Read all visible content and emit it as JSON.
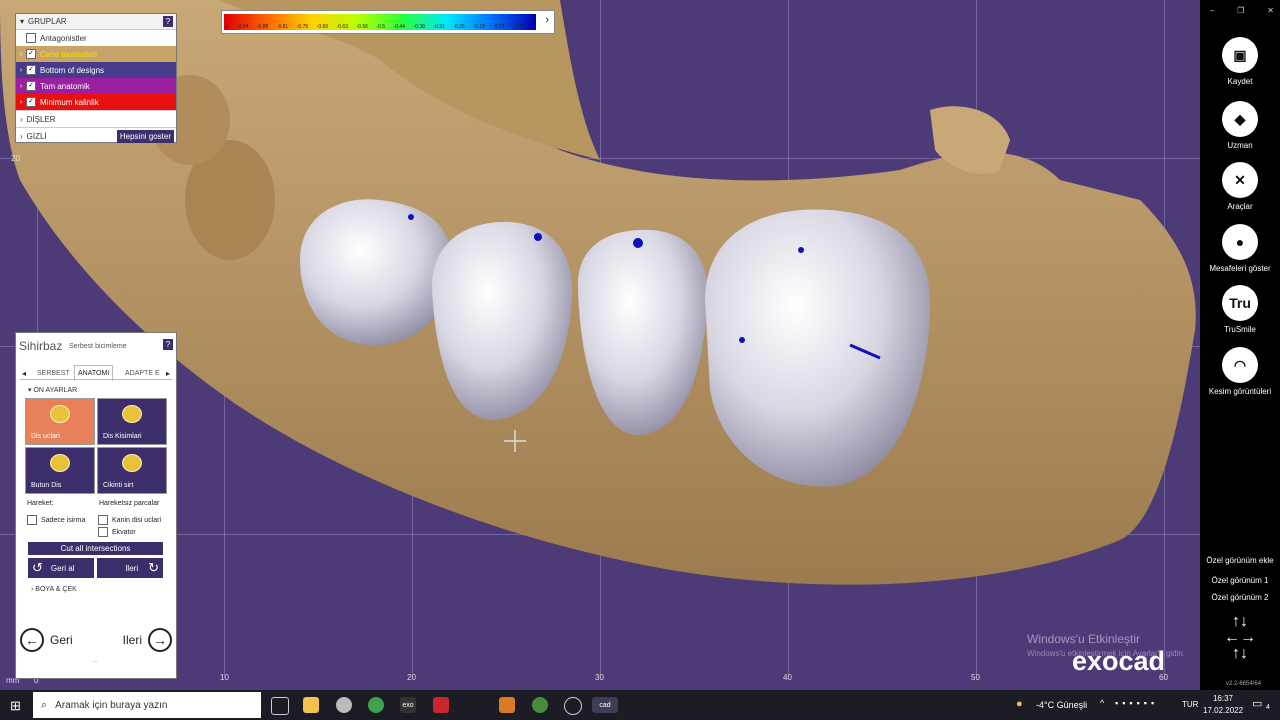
{
  "colorbar": {
    "ticks": [
      "-1",
      "-0.94",
      "-0.88",
      "-0.81",
      "-0.75",
      "-0.69",
      "-0.63",
      "-0.56",
      "-0.5",
      "-0.44",
      "-0.38",
      "-0.31",
      "-0.25",
      "-0.19",
      "-0.13",
      "-0.06",
      "0"
    ],
    "arrow": "›"
  },
  "groups": {
    "title": "GRUPLAR",
    "help": "?",
    "items": [
      {
        "label": "Antagonistler",
        "checked": false,
        "color": "#ffffff",
        "text_color": "#333333"
      },
      {
        "label": "Cene taramalari",
        "checked": true,
        "color": "#c8a46a",
        "text_color": "#f4e000"
      },
      {
        "label": "Bottom of designs",
        "checked": true,
        "color": "#4a3b8a",
        "text_color": "#ffffff"
      },
      {
        "label": "Tam anatomik",
        "checked": true,
        "color": "#9b1fa0",
        "text_color": "#ffffff"
      },
      {
        "label": "Minimum kalinlik",
        "checked": true,
        "color": "#e81010",
        "text_color": "#ffffff"
      }
    ],
    "disler": "DİŞLER",
    "gizli": "GİZLİ",
    "show_all": "Hepsini goster"
  },
  "wizard": {
    "title": "Sihirbaz",
    "subtitle": "Serbest bicimleme",
    "help": "?",
    "tabs": [
      "SERBEST",
      "ANATOMI",
      "ADAPTE E"
    ],
    "active_tab": "ANATOMI",
    "section": "ON AYARLAR",
    "tiles": [
      {
        "label": "Dis uclari",
        "selected": true
      },
      {
        "label": "Dis Kisimlari",
        "selected": false
      },
      {
        "label": "Butun Dis",
        "selected": false
      },
      {
        "label": "Cikinti sirt",
        "selected": false
      }
    ],
    "hareket_label": "Hareket:",
    "hareketsiz_label": "Hareketsiz parcalar",
    "sadece_isirma": "Sadece isirma",
    "kanin": "Kanin disi uclari",
    "ekvator": "Ekvator",
    "cut_all": "Cut all intersections",
    "undo": "Geri al",
    "redo": "Ileri",
    "boya": "BOYA & ÇEK",
    "back": "Geri",
    "next": "Ileri"
  },
  "sidebar": {
    "items": [
      {
        "label": "Kaydet",
        "icon": "save-icon"
      },
      {
        "label": "Uzman",
        "icon": "graduation-cap-icon"
      },
      {
        "label": "Araçlar",
        "icon": "tools-icon"
      },
      {
        "label": "Mesafeleri göster",
        "icon": "distance-icon"
      },
      {
        "label": "TruSmile",
        "icon": "trusmile-icon"
      },
      {
        "label": "Kesim görüntüleri",
        "icon": "cut-view-icon"
      }
    ],
    "trusmile_glyph": "Tru",
    "views": [
      "Özel görünüm ekle",
      "Özel görünüm 1",
      "Özel görünüm 2"
    ],
    "version": "v2.2-6654/64"
  },
  "viewport": {
    "x_ticks": [
      "10",
      "20",
      "30",
      "40",
      "50",
      "60"
    ],
    "y_tick": "20",
    "unit": "mm",
    "zero": "0",
    "watermark_title": "Windows'u Etkinleştir",
    "watermark_sub": "Windows'u etkinleştirmek için Ayarlar'a gidin.",
    "logo": "exocad"
  },
  "taskbar": {
    "search_placeholder": "Aramak için buraya yazın",
    "weather": "-4°C  Güneşli",
    "lang": "TUR",
    "time": "16:37",
    "date": "17.02.2022",
    "notif_count": "4",
    "apps": [
      "exo",
      "cad"
    ]
  }
}
